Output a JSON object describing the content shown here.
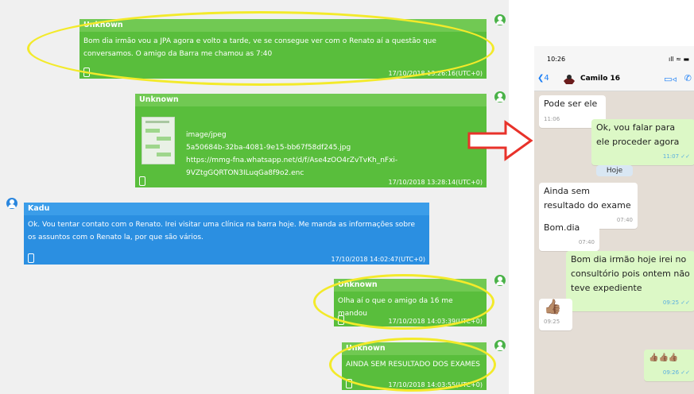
{
  "messages": [
    {
      "sender": "Unknown",
      "text": "Bom dia irmão vou a JPA agora e volto a tarde, ve se consegue ver com o Renato aí a questão que conversamos. O amigo da Barra me chamou as 7:40",
      "ts": "17/10/2018 13:26:16(UTC+0)"
    },
    {
      "sender": "Unknown",
      "mime": "image/jpeg",
      "file": "5a50684b-32ba-4081-9e15-bb67f58df245.jpg",
      "url": "https://mmg-fna.whatsapp.net/d/f/Ase4zOO4rZvTvKh_nFxi-9VZtgGQRTON3ILuqGa8f9o2.enc",
      "ts": "17/10/2018 13:28:14(UTC+0)"
    },
    {
      "sender": "Kadu",
      "text": "Ok. Vou tentar contato com o Renato. Irei visitar uma clínica na barra hoje. Me manda as informações sobre os assuntos com o Renato la, por que são vários.",
      "ts": "17/10/2018 14:02:47(UTC+0)"
    },
    {
      "sender": "Unknown",
      "text": "Olha aí o que o amigo da 16 me mandou",
      "ts": "17/10/2018 14:03:39(UTC+0)"
    },
    {
      "sender": "Unknown",
      "text": "AINDA SEM RESULTADO DOS EXAMES",
      "ts": "17/10/2018 14:03:55(UTC+0)"
    }
  ],
  "phone": {
    "time": "10:26",
    "signal": "ıll ≈ ▬",
    "back": "❮4",
    "contact": "Camilo 16",
    "video_icon": "video-icon",
    "call_icon": "phone-icon",
    "bubbles": [
      {
        "text": "Pode ser ele",
        "time": "11:06"
      },
      {
        "text": "Ok, vou falar para ele proceder agora",
        "time": "11:07 ✓✓"
      },
      {
        "text": "Ainda sem resultado do exame",
        "time": "07:40"
      },
      {
        "text": "Bom.dia",
        "time": "07:40"
      },
      {
        "text": "Bom dia irmão hoje irei no consultório pois ontem não teve expediente",
        "time": "09:25 ✓✓"
      },
      {
        "text": "👍🏽",
        "time": "09:25"
      },
      {
        "text": "👍🏽👍🏽👍🏽",
        "time": "09:26 ✓✓"
      }
    ],
    "day_label": "Hoje"
  },
  "colors": {
    "green": "#59be3c",
    "blue": "#2b8fe1",
    "highlight": "#f3ea2a",
    "arrow": "#e8322a"
  }
}
